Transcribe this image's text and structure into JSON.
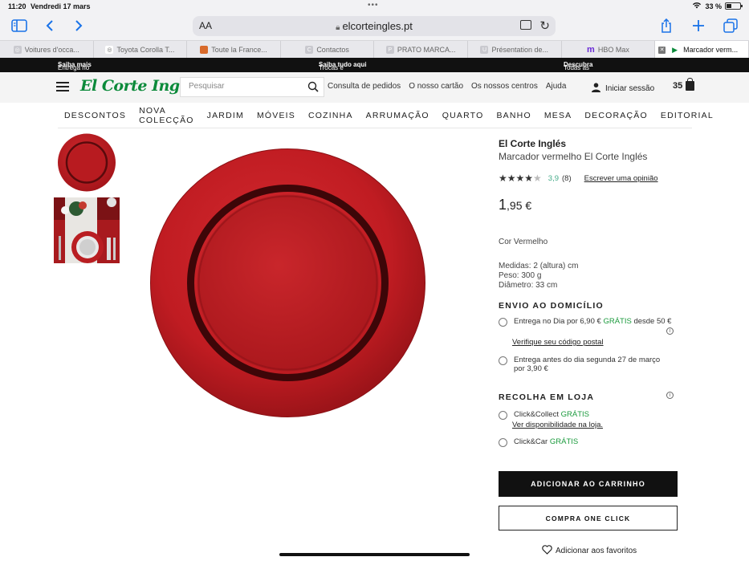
{
  "status_bar": {
    "time": "11:20",
    "date": "Vendredi 17 mars",
    "battery": "33 %"
  },
  "browser": {
    "text_size_label": "AA",
    "url": "elcorteingles.pt",
    "tabs": [
      {
        "label": "Voitures d'occa..."
      },
      {
        "label": "Toyota Corolla T..."
      },
      {
        "label": "Toute la France..."
      },
      {
        "label": "Contactos"
      },
      {
        "label": "PRATO MARCA..."
      },
      {
        "label": "Présentation de..."
      },
      {
        "label": "HBO Max"
      },
      {
        "label": "Marcador verm...",
        "active": true
      }
    ]
  },
  "promo_bar": {
    "left_text": "Entrega no dia à hora que quiser |",
    "left_link": "Saiba mais",
    "center_text": "Trocas e Devoluções |",
    "center_link": "Saiba tudo aqui",
    "right_text": "Todas as vantagens e serviços |",
    "right_link": "Descubra"
  },
  "header": {
    "logo": "El Corte Inglés",
    "search_placeholder": "Pesquisar",
    "links": [
      "Consulta de pedidos",
      "O nosso cartão",
      "Os nossos centros",
      "Ajuda"
    ],
    "login": "Iniciar sessão",
    "cart_count": "35"
  },
  "categories": [
    "DESCONTOS",
    "NOVA COLECÇÃO",
    "JARDIM",
    "MÓVEIS",
    "COZINHA",
    "ARRUMAÇÃO",
    "QUARTO",
    "BANHO",
    "MESA",
    "DECORAÇÃO",
    "EDITORIAL"
  ],
  "product": {
    "brand": "El Corte Inglés",
    "name": "Marcador vermelho El Corte Inglés",
    "rating": 3.9,
    "rating_score": "3,9",
    "rating_count": "(8)",
    "review_link": "Escrever uma opinião",
    "price_int": "1",
    "price_dec": ",95 €",
    "color": "Cor Vermelho",
    "dims": [
      "Medidas: 2 (altura) cm",
      "Peso: 300 g",
      "Diâmetro: 33 cm"
    ],
    "plate_color": "#c41f24"
  },
  "delivery": {
    "title": "ENVIO AO DOMICÍLIO",
    "opt1_a": "Entrega no Dia por 6,90 €",
    "opt1_free": "GRÁTIS",
    "opt1_b": "desde 50 €",
    "postal_link": "Verifique seu código postal",
    "opt2_line1": "Entrega antes do dia segunda 27 de março",
    "opt2_line2": "por 3,90 €"
  },
  "pickup": {
    "title": "RECOLHA EM LOJA",
    "opt1": "Click&Collect",
    "opt1_free": "GRÁTIS",
    "availability_link": "Ver disponibilidade na loja.",
    "opt2": "Click&Car",
    "opt2_free": "GRÁTIS"
  },
  "actions": {
    "add_to_cart": "ADICIONAR AO CARRINHO",
    "one_click": "COMPRA ONE CLICK",
    "favorites": "Adicionar aos favoritos"
  }
}
